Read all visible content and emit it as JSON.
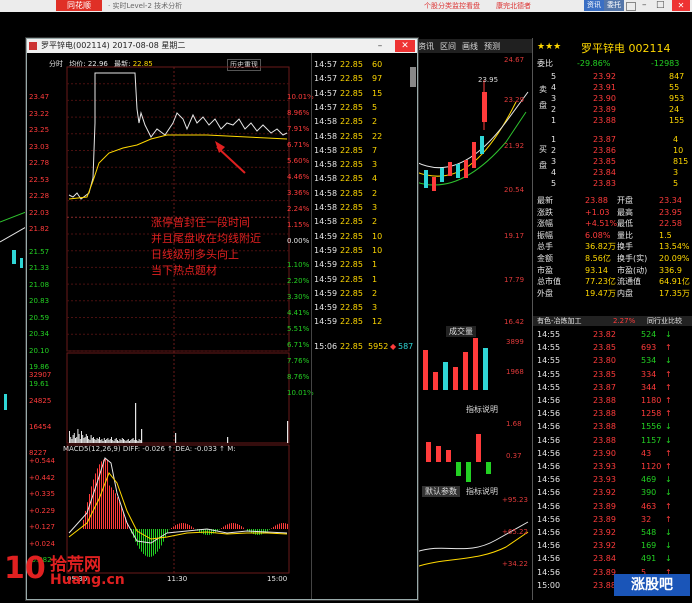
{
  "topbar": {
    "logo": "同花顺",
    "title": "· 实时Level-2 技术分析",
    "ad": "个股分类监控看盘",
    "ad2": "康完北德者",
    "btn1": "资讯",
    "btn2": "委托"
  },
  "popup": {
    "title": "罗平锌电(002114) 2017-08-08 星期二",
    "info": {
      "label1": "分时",
      "label2": "均价:",
      "avg": "22.96",
      "label3": "最新:",
      "last": "22.85",
      "history_btn": "历史重现"
    },
    "price_ticks": [
      "23.47",
      "23.22",
      "23.25",
      "23.03",
      "22.78",
      "22.53",
      "22.28",
      "22.03",
      "21.82",
      "21.57",
      "21.33",
      "21.08",
      "20.83",
      "20.59",
      "20.34",
      "20.10",
      "19.86",
      "19.61"
    ],
    "pct_ticks": [
      "10.01%",
      "8.96%",
      "7.91%",
      "6.71%",
      "5.60%",
      "4.46%",
      "3.36%",
      "2.24%",
      "1.15%",
      "0.00%",
      "1.10%",
      "2.20%",
      "3.30%",
      "4.41%",
      "5.51%",
      "6.71%",
      "7.76%",
      "8.76%",
      "10.01%"
    ],
    "vol_ticks": [
      "32907",
      "24825",
      "16454",
      "8227"
    ],
    "macd_label": "MACD5(12,26,9) DIFF: -0.026 ↑ DEA: -0.033 ↑ M:",
    "macd_ticks": [
      "+0.544",
      "+0.442",
      "+0.335",
      "+0.229",
      "+0.127",
      "+0.024",
      "-0.082"
    ],
    "time_ticks": [
      "09:30",
      "11:30",
      "15:00"
    ],
    "annotation": [
      "涨停曾封住一段时间",
      "并且尾盘收在均线附近",
      "日线级别多头向上",
      "当下热点题材"
    ],
    "trades": [
      {
        "t": "14:57",
        "p": "22.85",
        "v": "60"
      },
      {
        "t": "14:57",
        "p": "22.85",
        "v": "97"
      },
      {
        "t": "14:57",
        "p": "22.85",
        "v": "15"
      },
      {
        "t": "14:57",
        "p": "22.85",
        "v": "5"
      },
      {
        "t": "14:58",
        "p": "22.85",
        "v": "2"
      },
      {
        "t": "14:58",
        "p": "22.85",
        "v": "22"
      },
      {
        "t": "14:58",
        "p": "22.85",
        "v": "7"
      },
      {
        "t": "14:58",
        "p": "22.85",
        "v": "3"
      },
      {
        "t": "14:58",
        "p": "22.85",
        "v": "4"
      },
      {
        "t": "14:58",
        "p": "22.85",
        "v": "2"
      },
      {
        "t": "14:58",
        "p": "22.85",
        "v": "3"
      },
      {
        "t": "14:58",
        "p": "22.85",
        "v": "2"
      },
      {
        "t": "14:59",
        "p": "22.85",
        "v": "10"
      },
      {
        "t": "14:59",
        "p": "22.85",
        "v": "10"
      },
      {
        "t": "14:59",
        "p": "22.85",
        "v": "1"
      },
      {
        "t": "14:59",
        "p": "22.85",
        "v": "1"
      },
      {
        "t": "14:59",
        "p": "22.85",
        "v": "2"
      },
      {
        "t": "14:59",
        "p": "22.85",
        "v": "3"
      },
      {
        "t": "14:59",
        "p": "22.85",
        "v": "12"
      }
    ],
    "last_trade": {
      "t": "15:06",
      "p": "22.85",
      "v": "5952",
      "n": "587"
    }
  },
  "bgchart": {
    "toolbar": [
      "资讯",
      "区间",
      "画线",
      "预测"
    ],
    "price_labels": [
      "24.67",
      "23.29",
      "21.92",
      "20.54",
      "19.17",
      "17.79",
      "16.42"
    ],
    "high_label": "23.95",
    "vol_label": "成交量",
    "vol_ticks": [
      "3899",
      "1968"
    ],
    "ind_label": "指标说明",
    "ind_ticks": [
      "1.68",
      "0.37"
    ],
    "bottom_tabs": [
      "默认参数",
      "指标说明"
    ],
    "bottom_ticks": [
      "+95.23",
      "+65.22",
      "+34.22"
    ]
  },
  "quote": {
    "name": "罗平锌电 002114",
    "wb": {
      "label": "委比",
      "ratio": "-29.86%",
      "diff": "-12983"
    },
    "sells": [
      {
        "n": "5",
        "p": "23.92",
        "v": "847"
      },
      {
        "n": "4",
        "p": "23.91",
        "v": "55"
      },
      {
        "n": "3",
        "p": "23.90",
        "v": "953"
      },
      {
        "n": "2",
        "p": "23.89",
        "v": "24"
      },
      {
        "n": "1",
        "p": "23.88",
        "v": "155"
      }
    ],
    "buys": [
      {
        "n": "1",
        "p": "23.87",
        "v": "4"
      },
      {
        "n": "2",
        "p": "23.86",
        "v": "10"
      },
      {
        "n": "3",
        "p": "23.85",
        "v": "815"
      },
      {
        "n": "4",
        "p": "23.84",
        "v": "3"
      },
      {
        "n": "5",
        "p": "23.83",
        "v": "5"
      }
    ],
    "sell_label": "卖盘",
    "buy_label": "买盘",
    "stats": [
      {
        "k1": "最新",
        "v1": "23.88",
        "k2": "开盘",
        "v2": "23.34"
      },
      {
        "k1": "涨跌",
        "v1": "+1.03",
        "k2": "最高",
        "v2": "23.95"
      },
      {
        "k1": "涨幅",
        "v1": "+4.51%",
        "k2": "最低",
        "v2": "22.58"
      },
      {
        "k1": "振幅",
        "v1": "6.08%",
        "k2": "量比",
        "v2": "1.5"
      },
      {
        "k1": "总手",
        "v1": "36.82万",
        "k2": "换手",
        "v2": "13.54%"
      },
      {
        "k1": "金额",
        "v1": "8.56亿",
        "k2": "换手(实)",
        "v2": "20.09%"
      },
      {
        "k1": "市盈",
        "v1": "93.14",
        "k2": "市盈(动)",
        "v2": "336.9"
      },
      {
        "k1": "总市值",
        "v1": "77.23亿",
        "k2": "流通值",
        "v2": "64.91亿"
      },
      {
        "k1": "外盘",
        "v1": "19.47万",
        "k2": "内盘",
        "v2": "17.35万"
      }
    ],
    "industry": "有色-冶炼加工",
    "industry_pct": "2.27%",
    "industry_tab": "同行业比较",
    "ticks": [
      {
        "t": "14:55",
        "p": "23.82",
        "v": "524",
        "d": "down"
      },
      {
        "t": "14:55",
        "p": "23.85",
        "v": "693",
        "d": "up"
      },
      {
        "t": "14:55",
        "p": "23.80",
        "v": "534",
        "d": "down"
      },
      {
        "t": "14:55",
        "p": "23.85",
        "v": "334",
        "d": "up"
      },
      {
        "t": "14:55",
        "p": "23.87",
        "v": "344",
        "d": "up"
      },
      {
        "t": "14:56",
        "p": "23.88",
        "v": "1180",
        "d": "up"
      },
      {
        "t": "14:56",
        "p": "23.88",
        "v": "1258",
        "d": "up"
      },
      {
        "t": "14:56",
        "p": "23.88",
        "v": "1556",
        "d": "down"
      },
      {
        "t": "14:56",
        "p": "23.88",
        "v": "1157",
        "d": "down"
      },
      {
        "t": "14:56",
        "p": "23.90",
        "v": "43",
        "d": "up"
      },
      {
        "t": "14:56",
        "p": "23.93",
        "v": "1120",
        "d": "up"
      },
      {
        "t": "14:56",
        "p": "23.93",
        "v": "469",
        "d": "down"
      },
      {
        "t": "14:56",
        "p": "23.92",
        "v": "390",
        "d": "down"
      },
      {
        "t": "14:56",
        "p": "23.89",
        "v": "463",
        "d": "up"
      },
      {
        "t": "14:56",
        "p": "23.89",
        "v": "32",
        "d": "up"
      },
      {
        "t": "14:56",
        "p": "23.92",
        "v": "548",
        "d": "down"
      },
      {
        "t": "14:56",
        "p": "23.92",
        "v": "169",
        "d": "down"
      },
      {
        "t": "14:56",
        "p": "23.84",
        "v": "491",
        "d": "down"
      },
      {
        "t": "14:56",
        "p": "23.89",
        "v": "5",
        "d": "up"
      },
      {
        "t": "15:00",
        "p": "23.88",
        "v": "10031",
        "d": "up"
      }
    ]
  },
  "watermark": {
    "big": "10",
    "cn": "拾荒网",
    "en": "Huang.cn",
    "br": "涨股吧"
  },
  "colors": {
    "up": "#ff3b3b",
    "down": "#23d023",
    "accent": "#ffd800",
    "grid": "#5a1a1a"
  }
}
